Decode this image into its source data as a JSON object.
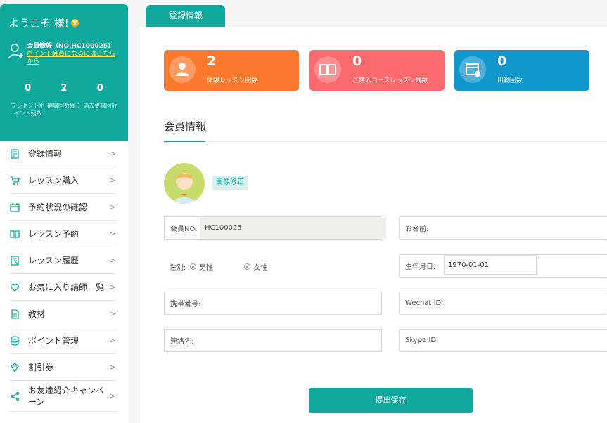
{
  "sidebar": {
    "welcome": "ようこそ 様!",
    "vip_badge": "V",
    "member_title": "会員情報（NO.HC100025)",
    "member_link": "ポイント会員になるにはこちらから",
    "stats": [
      {
        "value": "0",
        "label": "プレゼントポイント残数"
      },
      {
        "value": "2",
        "label": "補講回数残り"
      },
      {
        "value": "0",
        "label": "過去受講回数"
      }
    ],
    "menu": [
      {
        "label": "登録情報",
        "icon": "document-icon"
      },
      {
        "label": "レッスン購入",
        "icon": "cart-icon"
      },
      {
        "label": "予約状況の確認",
        "icon": "calendar-icon"
      },
      {
        "label": "レッスン予約",
        "icon": "book-icon"
      },
      {
        "label": "レッスン履歴",
        "icon": "history-icon"
      },
      {
        "label": "お気に入り講師一覧",
        "icon": "heart-icon"
      },
      {
        "label": "教材",
        "icon": "file-icon"
      },
      {
        "label": "ポイント管理",
        "icon": "coins-icon"
      },
      {
        "label": "割引券",
        "icon": "coupon-icon"
      },
      {
        "label": "お友達紹介キャンペーン",
        "icon": "share-icon"
      }
    ],
    "chevron": ">"
  },
  "tab": {
    "label": "登録情報"
  },
  "cards": [
    {
      "value": "2",
      "label": "体験レッスン回数",
      "color": "#fc7a2e",
      "icon": "person-icon"
    },
    {
      "value": "0",
      "label": "ご購入コースレッスン残数",
      "color": "#fb6a6c",
      "icon": "book-icon"
    },
    {
      "value": "0",
      "label": "出勤回数",
      "color": "#1098cd",
      "icon": "calendar-check-icon"
    }
  ],
  "section": {
    "title": "会員情報"
  },
  "avatar": {
    "edit_label": "画像修正"
  },
  "form": {
    "member_no_label": "会員NO:",
    "member_no_value": "HC100025",
    "name_label": "お名前:",
    "gender_label": "性別:",
    "gender_male": "男性",
    "gender_female": "女性",
    "birth_label": "生年月日:",
    "birth_value": "1970-01-01",
    "mobile_label": "携帯番号:",
    "wechat_label": "Wechat ID:",
    "contact_label": "連絡先:",
    "skype_label": "Skype ID:"
  },
  "submit_label": "提出保存",
  "colors": {
    "accent": "#0fa89c",
    "link": "#ffe44d"
  }
}
